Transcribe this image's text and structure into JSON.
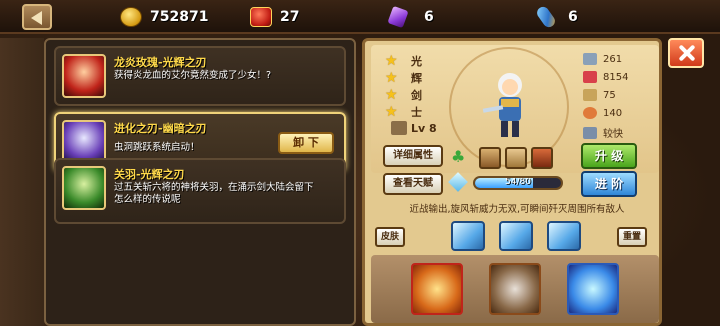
{
  "resources": [
    {
      "name": "gold",
      "value": "752871"
    },
    {
      "name": "medal",
      "value": "27"
    },
    {
      "name": "gem",
      "value": "6"
    },
    {
      "name": "key",
      "value": "6"
    }
  ],
  "skins": [
    {
      "title": "龙炎玫瑰-光辉之刃",
      "desc": "获得炎龙血的艾尔竟然变成了少女！?"
    },
    {
      "title": "进化之刃-幽暗之刃",
      "desc": "虫洞跳跃系统启动！",
      "action": "卸 下"
    },
    {
      "title": "关羽-光辉之刃",
      "desc": "过五关斩六将的神将关羽，在涌示剑大陆会留下怎么样的传说呢"
    }
  ],
  "hero": {
    "ranks": [
      "光",
      "辉",
      "剑",
      "士"
    ],
    "level": "Lv 8",
    "stats": [
      "261",
      "8154",
      "75",
      "140",
      "较快"
    ],
    "detail_btn": "详细属性",
    "talent_btn": "查看天赋",
    "upgrade_btn": "升 级",
    "advance_btn": "进 阶",
    "progress_text": "54/80",
    "progress_value": 0.675,
    "skill_desc": "近战输出,旋风斩威力无双,可瞬间歼灭周围所有敌人",
    "skin_btn": "皮肤",
    "reset_btn": "重置"
  }
}
